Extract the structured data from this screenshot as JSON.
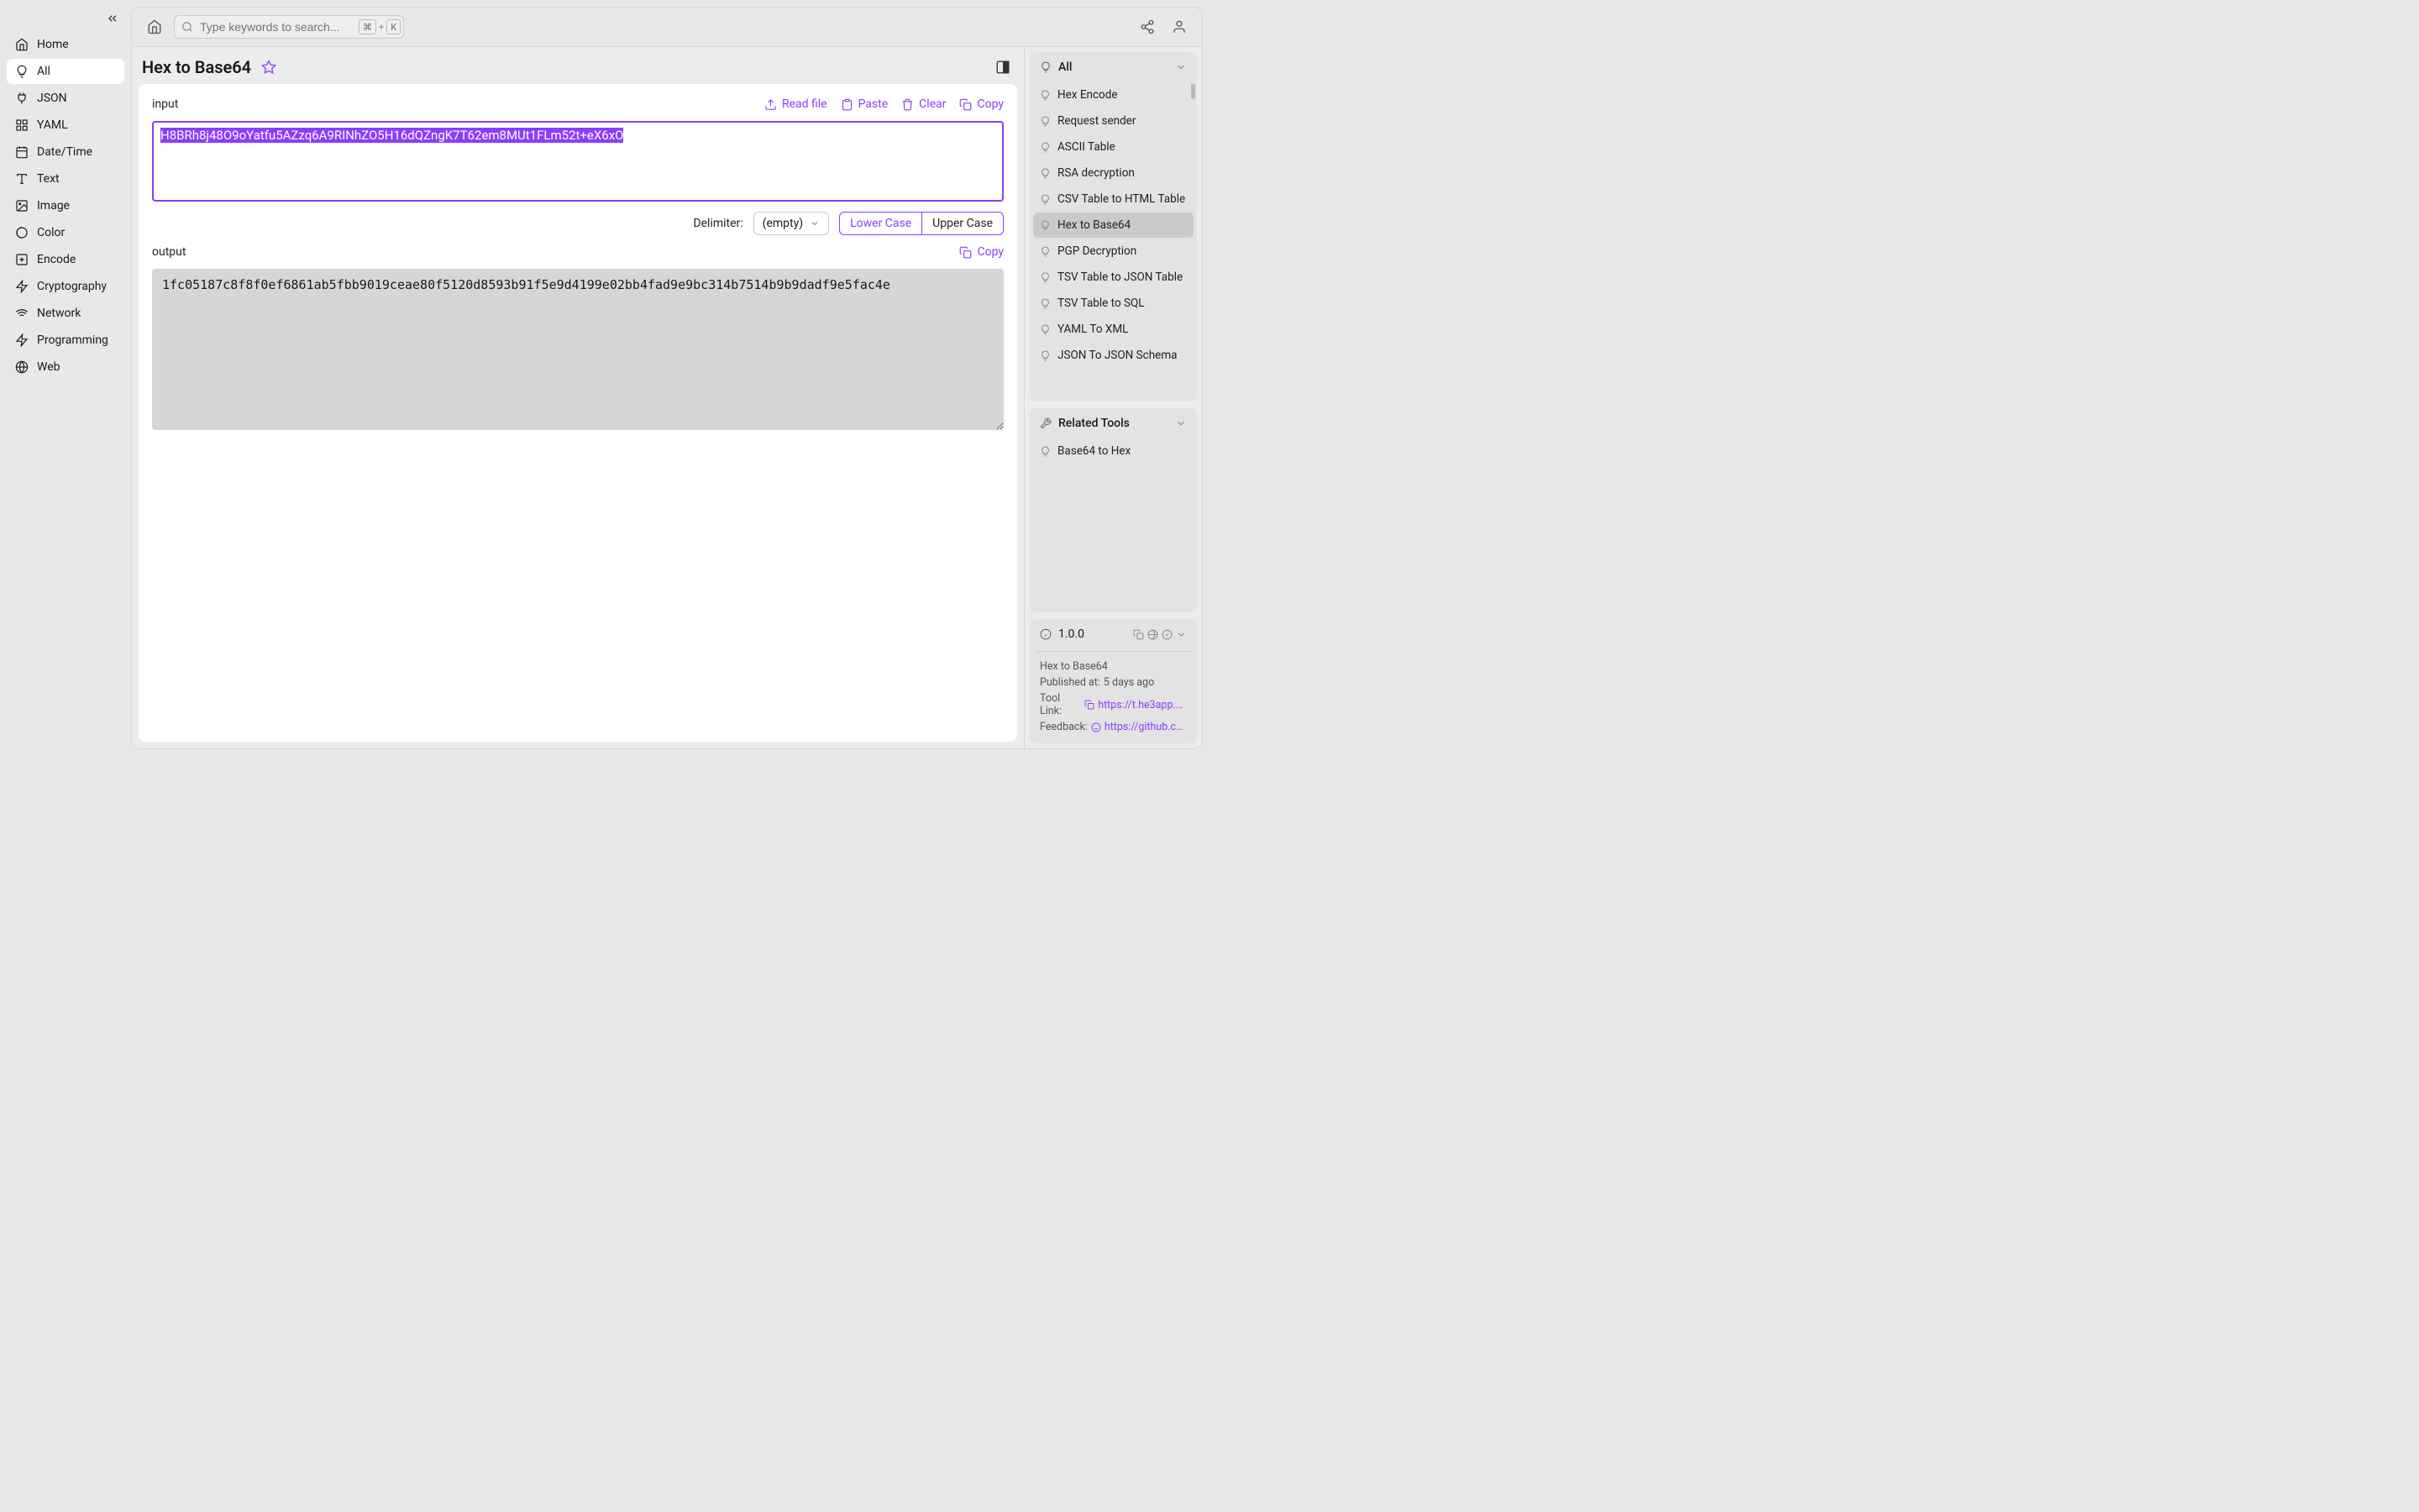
{
  "sidebar": {
    "items": [
      {
        "label": "Home"
      },
      {
        "label": "All"
      },
      {
        "label": "JSON"
      },
      {
        "label": "YAML"
      },
      {
        "label": "Date/Time"
      },
      {
        "label": "Text"
      },
      {
        "label": "Image"
      },
      {
        "label": "Color"
      },
      {
        "label": "Encode"
      },
      {
        "label": "Cryptography"
      },
      {
        "label": "Network"
      },
      {
        "label": "Programming"
      },
      {
        "label": "Web"
      }
    ]
  },
  "search": {
    "placeholder": "Type keywords to search..."
  },
  "keyboard_shortcut": {
    "mod": "⌘",
    "plus": "+",
    "key": "K"
  },
  "main": {
    "title": "Hex to Base64",
    "input_label": "input",
    "input_value": "H8BRh8j48O9oYatfu5AZzq6A9RINhZO5H16dQZngK7T62em8MUt1FLm52t+eX6xO",
    "actions": {
      "read_file": "Read file",
      "paste": "Paste",
      "clear": "Clear",
      "copy": "Copy"
    },
    "delimiter_label": "Delimiter:",
    "delimiter_value": "(empty)",
    "case_lower": "Lower Case",
    "case_upper": "Upper Case",
    "output_label": "output",
    "output_copy": "Copy",
    "output_value": "1fc05187c8f8f0ef6861ab5fbb9019ceae80f5120d8593b91f5e9d4199e02bb4fad9e9bc314b7514b9b9dadf9e5fac4e"
  },
  "right_panel": {
    "all_label": "All",
    "all_items": [
      "Hex Encode",
      "Request sender",
      "ASCII Table",
      "RSA decryption",
      "CSV Table to HTML Table",
      "Hex to Base64",
      "PGP Decryption",
      "TSV Table to JSON Table",
      "TSV Table to SQL",
      "YAML To XML",
      "JSON To JSON Schema"
    ],
    "related_label": "Related Tools",
    "related_items": [
      "Base64 to Hex"
    ],
    "info": {
      "version": "1.0.0",
      "name": "Hex to Base64",
      "published_label": "Published at:",
      "published_value": "5 days ago",
      "tool_link_label": "Tool Link:",
      "tool_link_value": "https://t.he3app.co…",
      "feedback_label": "Feedback:",
      "feedback_value": "https://github.com/…"
    }
  }
}
